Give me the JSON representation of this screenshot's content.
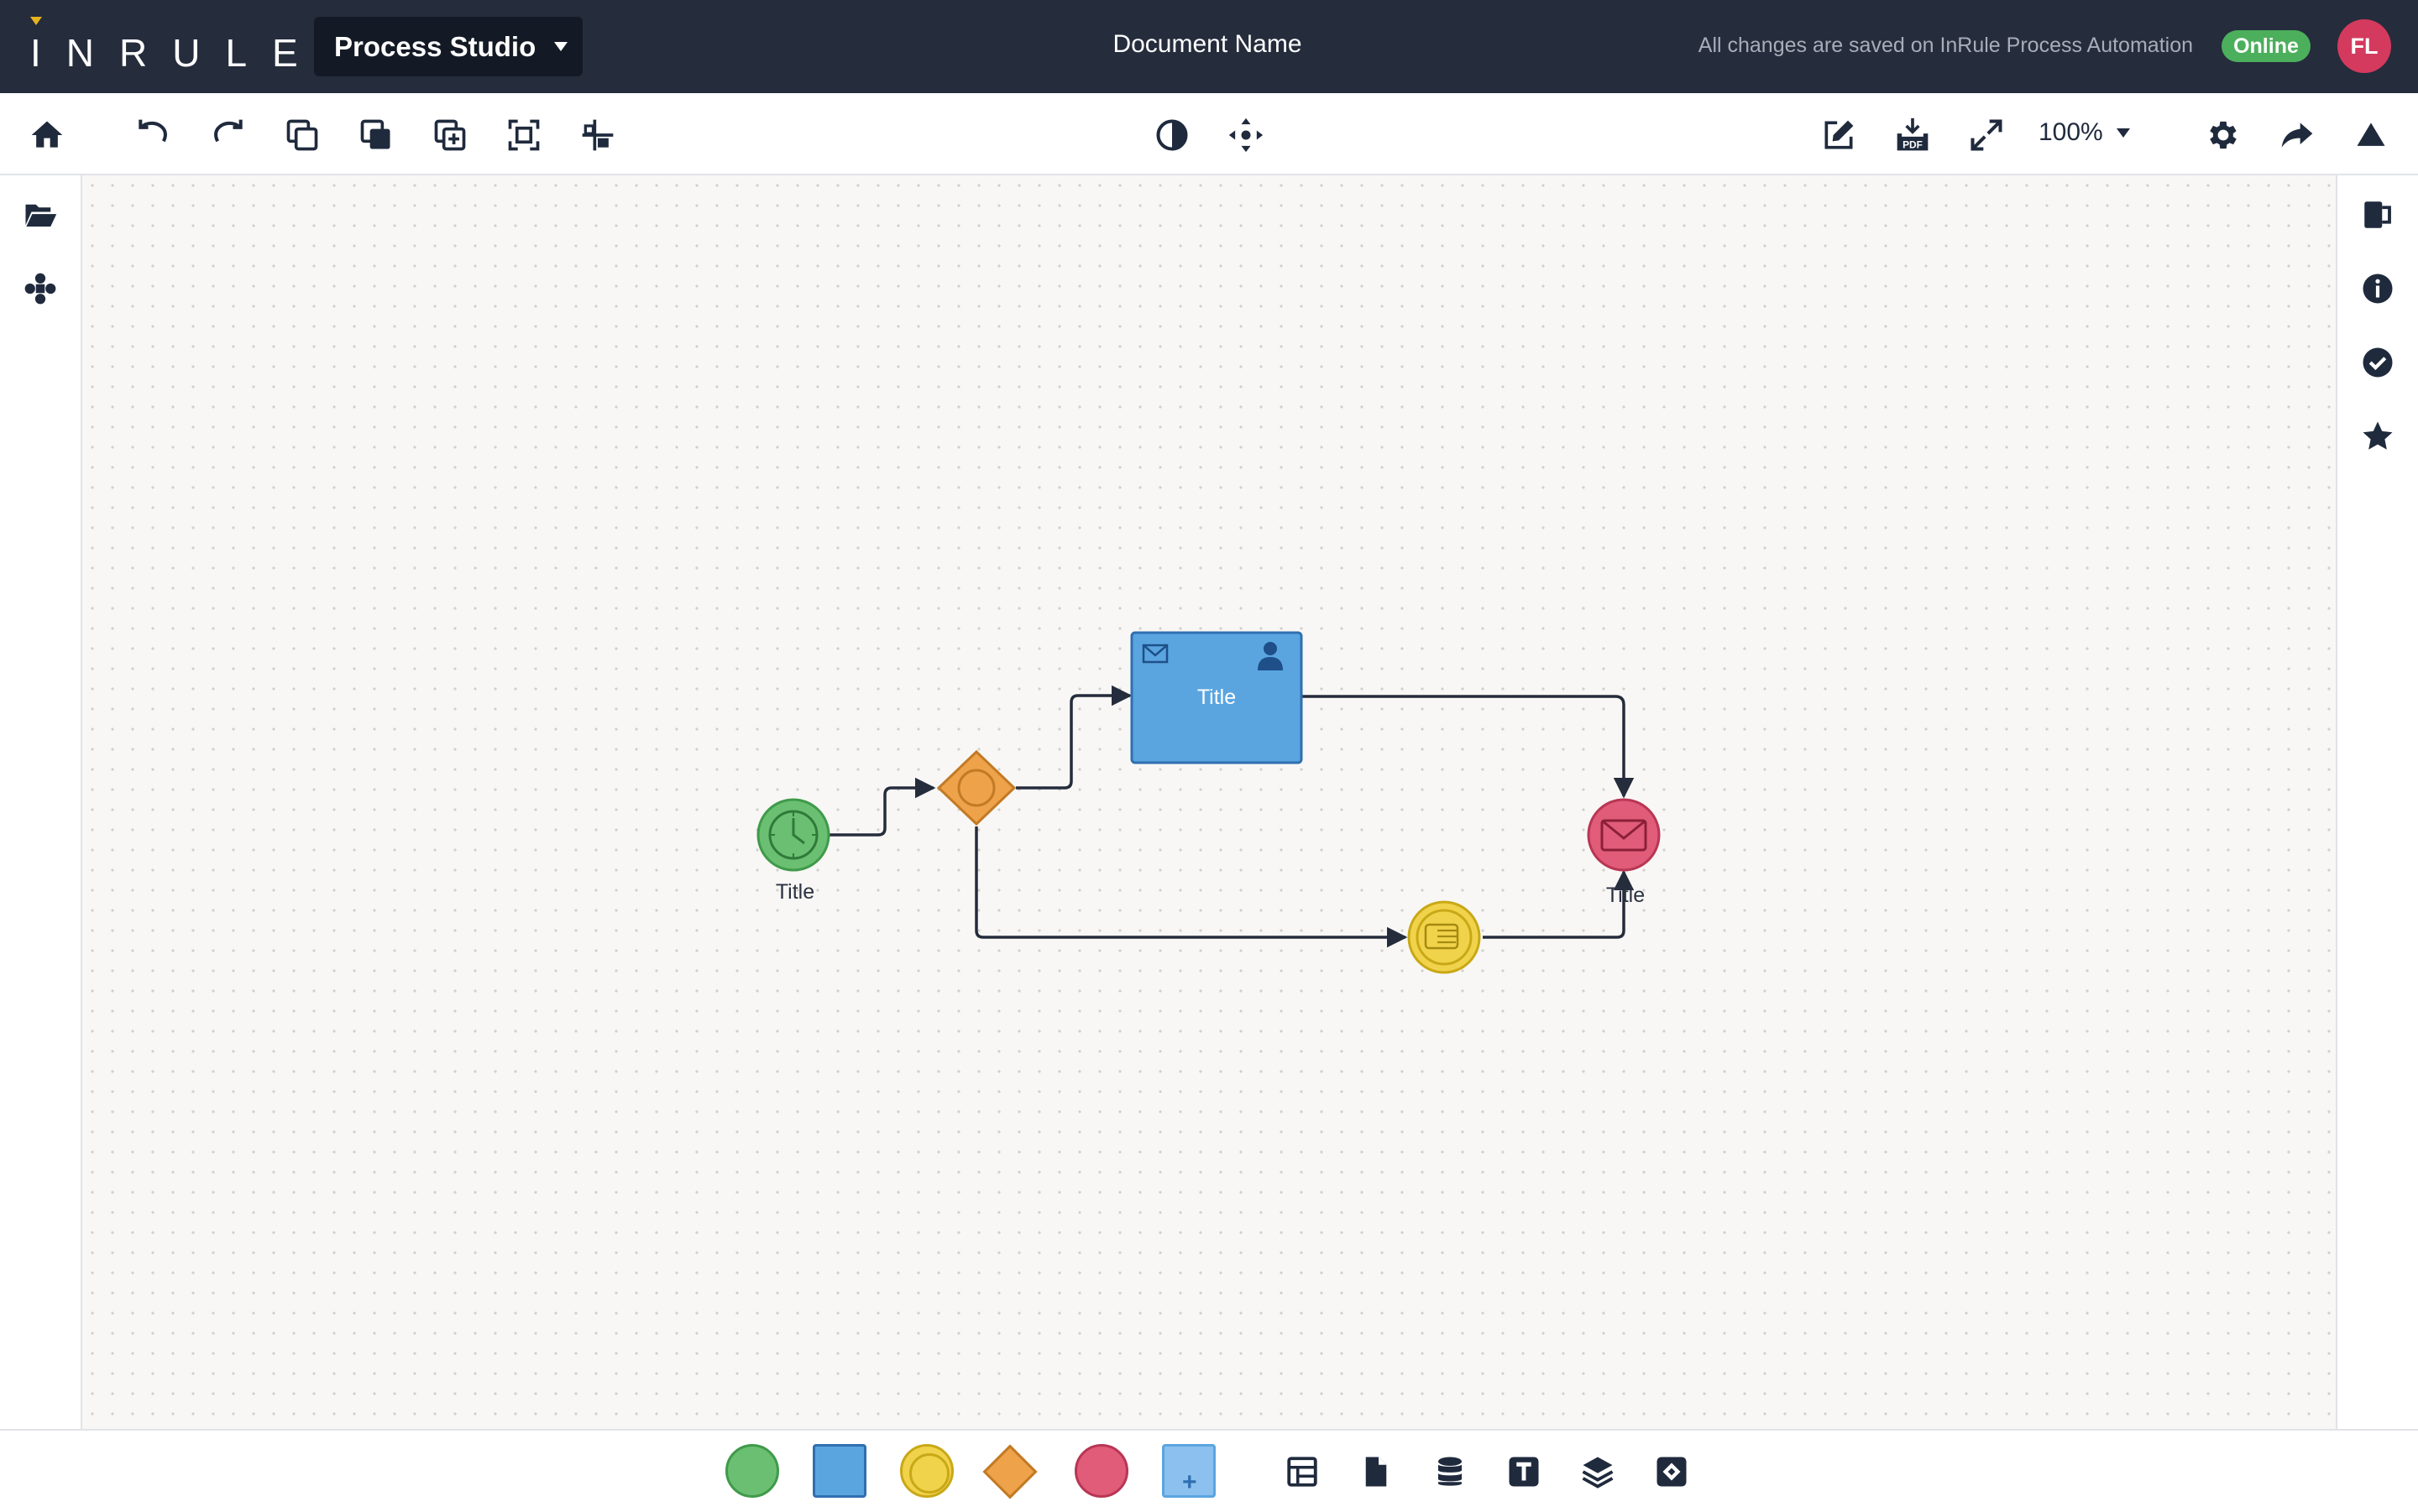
{
  "header": {
    "logo_text": "INRULE",
    "product_label": "Process Studio",
    "document_name": "Document Name",
    "save_status": "All changes are saved on InRule Process Automation",
    "online_badge": "Online",
    "avatar_initials": "FL"
  },
  "toolbar": {
    "left_icons": [
      "home-icon",
      "undo-icon",
      "redo-icon",
      "duplicate-icon",
      "bring-front-icon",
      "add-copy-icon",
      "select-all-icon",
      "align-icon"
    ],
    "center_icons": [
      "contrast-icon",
      "move-icon"
    ],
    "right_icons": [
      "edit-icon",
      "pdf-download-icon",
      "fullscreen-icon",
      "settings-icon",
      "share-icon",
      "collapse-icon"
    ],
    "zoom": "100%"
  },
  "left_sidebar": {
    "icons": [
      "folder-open-icon",
      "components-icon"
    ]
  },
  "right_sidebar": {
    "icons": [
      "panel-icon",
      "info-icon",
      "validate-icon",
      "favorite-icon"
    ]
  },
  "diagram": {
    "start_event_label": "Title",
    "task_label": "Title",
    "end_event_label": "Title",
    "nodes": [
      "timer-start-event",
      "exclusive-gateway",
      "user-task",
      "intermediate-event",
      "message-end-event"
    ]
  },
  "palette": {
    "shapes": [
      "start-event-shape",
      "task-shape",
      "intermediate-event-shape",
      "gateway-shape",
      "end-event-shape",
      "subprocess-shape"
    ],
    "tools": [
      "table-icon",
      "document-icon",
      "database-icon",
      "text-icon",
      "layers-icon",
      "embed-icon"
    ]
  },
  "colors": {
    "header_bg": "#252c3c",
    "accent_yellow": "#e8b21e",
    "start_green": "#6bbf72",
    "task_blue": "#5aa5e0",
    "intermediate_yellow": "#f1d34b",
    "gateway_orange": "#eea24a",
    "end_red": "#e05c78",
    "online_green": "#4caf5c",
    "avatar_red": "#d43a5e"
  }
}
